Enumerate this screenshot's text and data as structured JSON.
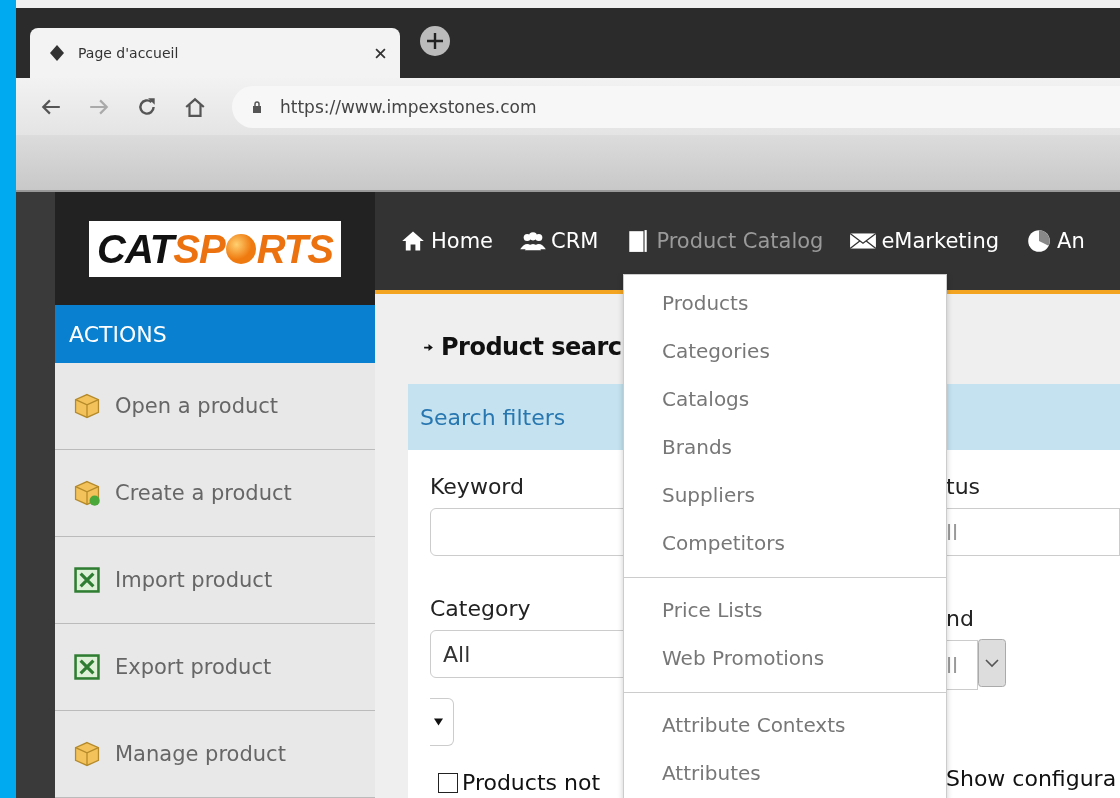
{
  "browser": {
    "tab": {
      "title": "Page d'accueil"
    },
    "url": "https://www.impexstones.com"
  },
  "logo": {
    "dark": "CAT",
    "bright_before": "SP",
    "bright_after": "RTS"
  },
  "sidebar": {
    "title": "ACTIONS",
    "items": [
      {
        "label": "Open a product",
        "kind": "box"
      },
      {
        "label": "Create a product",
        "kind": "box-new"
      },
      {
        "label": "Import product",
        "kind": "sheet"
      },
      {
        "label": "Export product",
        "kind": "sheet"
      },
      {
        "label": "Manage product",
        "kind": "box"
      }
    ]
  },
  "nav": [
    {
      "label": "Home",
      "kind": "home",
      "selected": false
    },
    {
      "label": "CRM",
      "kind": "people",
      "selected": false
    },
    {
      "label": "Product Catalog",
      "kind": "book",
      "selected": true
    },
    {
      "label": "eMarketing",
      "kind": "mail",
      "selected": false
    },
    {
      "label": "An",
      "kind": "pie",
      "selected": false
    }
  ],
  "menu": {
    "groups": [
      [
        "Products",
        "Categories",
        "Catalogs",
        "Brands",
        "Suppliers",
        "Competitors"
      ],
      [
        "Price Lists",
        "Web Promotions"
      ],
      [
        "Attribute Contexts",
        "Attributes"
      ]
    ]
  },
  "page_title": "Product searc",
  "filters": {
    "title": "Search filters",
    "keyword": {
      "label": "Keyword"
    },
    "category": {
      "label": "Category",
      "value": "All"
    },
    "checkbox": {
      "label": "Products not",
      "checked": false
    },
    "status": {
      "label": "tus",
      "value": "ll"
    },
    "brand": {
      "label": "nd",
      "value": "ll"
    },
    "show": {
      "label": "Show configura"
    }
  }
}
